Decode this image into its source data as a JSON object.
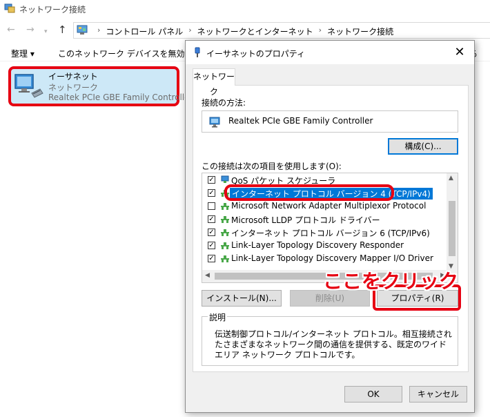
{
  "window": {
    "title": "ネットワーク接続"
  },
  "address": {
    "crumbs": [
      "コントロール パネル",
      "ネットワークとインターネット",
      "ネットワーク接続"
    ]
  },
  "commands": {
    "organize": "整理 ▾",
    "disable": "このネットワーク デバイスを無効にする",
    "right_fragment": "る"
  },
  "adapter": {
    "name": "イーサネット",
    "status": "ネットワーク",
    "device": "Realtek PCIe GBE Family Controller"
  },
  "dialog": {
    "title": "イーサネットのプロパティ",
    "close": "✕",
    "tab": "ネットワーク",
    "connect_using_label": "接続の方法:",
    "device_name": "Realtek PCIe GBE Family Controller",
    "configure_button": "構成(C)...",
    "items_label": "この接続は次の項目を使用します(O):",
    "items": [
      {
        "checked": true,
        "label": "QoS パケット スケジューラ"
      },
      {
        "checked": true,
        "label": "インターネット プロトコル バージョン 4 (TCP/IPv4)"
      },
      {
        "checked": false,
        "label": "Microsoft Network Adapter Multiplexor Protocol"
      },
      {
        "checked": true,
        "label": "Microsoft LLDP プロトコル ドライバー"
      },
      {
        "checked": true,
        "label": "インターネット プロトコル バージョン 6 (TCP/IPv6)"
      },
      {
        "checked": true,
        "label": "Link-Layer Topology Discovery Responder"
      },
      {
        "checked": true,
        "label": "Link-Layer Topology Discovery Mapper I/O Driver"
      }
    ],
    "selected_index": 1,
    "install_button": "インストール(N)...",
    "remove_button": "削除(U)",
    "properties_button": "プロパティ(R)",
    "description_legend": "説明",
    "description_text": "伝送制御プロトコル/インターネット プロトコル。相互接続されたさまざまなネットワーク間の通信を提供する、既定のワイド エリア ネットワーク プロトコルです。",
    "ok_button": "OK",
    "cancel_button": "キャンセル"
  },
  "annotation": {
    "callout": "ここをクリック"
  },
  "colors": {
    "highlight": "#e60012",
    "selection": "#0078d7",
    "adapter_bg": "#cde8f7"
  },
  "icons": {
    "window": "network-folder-icon",
    "control_panel": "control-panel-icon",
    "adapter": "ethernet-adapter-icon",
    "dialog": "plug-icon",
    "nic": "nic-icon",
    "protocol": "protocol-icon"
  }
}
